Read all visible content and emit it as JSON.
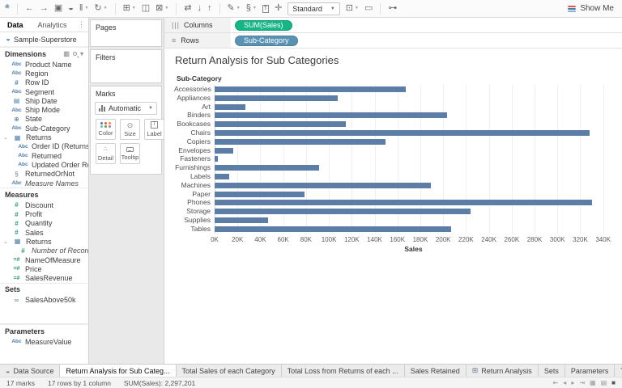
{
  "toolbar": {
    "icons": [
      {
        "name": "tableau-logo-icon",
        "glyph": "*",
        "logo": true
      },
      {
        "divider": true
      },
      {
        "name": "undo-icon",
        "glyph": "←"
      },
      {
        "name": "redo-icon",
        "glyph": "→"
      },
      {
        "name": "save-icon",
        "glyph": "▣"
      },
      {
        "name": "new-datasource-icon",
        "glyph": "◒"
      },
      {
        "name": "pause-auto-updates-icon",
        "glyph": "‖",
        "caret": true
      },
      {
        "name": "run-auto-updates-icon",
        "glyph": "↻",
        "caret": true
      },
      {
        "divider": true
      },
      {
        "name": "new-worksheet-icon",
        "glyph": "⊞",
        "caret": true
      },
      {
        "name": "duplicate-sheet-icon",
        "glyph": "◫"
      },
      {
        "name": "clear-sheet-icon",
        "glyph": "⊠",
        "caret": true
      },
      {
        "divider": true
      },
      {
        "name": "swap-rows-columns-icon",
        "glyph": "⇄"
      },
      {
        "name": "sort-ascending-icon",
        "glyph": "↓"
      },
      {
        "name": "sort-descending-icon",
        "glyph": "↑"
      },
      {
        "divider": true
      },
      {
        "name": "highlight-icon",
        "glyph": "✎",
        "caret": true
      },
      {
        "name": "group-members-icon",
        "glyph": "§",
        "caret": true
      },
      {
        "name": "show-mark-labels-icon",
        "glyph": "T",
        "boxed": true
      },
      {
        "name": "fix-axes-icon",
        "glyph": "✛"
      }
    ],
    "fit_mode": "Standard",
    "right_icons": [
      {
        "name": "fit-selector-icon",
        "glyph": "⊡",
        "caret": true
      },
      {
        "name": "presentation-mode-icon",
        "glyph": "▭"
      },
      {
        "divider": true
      },
      {
        "name": "share-icon",
        "glyph": "⊶"
      }
    ],
    "show_me_label": "Show Me",
    "show_me_colors": [
      "#e15759",
      "#4e79a7",
      "#86b4d8"
    ]
  },
  "sidebar": {
    "tabs": [
      {
        "label": "Data",
        "active": true
      },
      {
        "label": "Analytics",
        "active": false
      }
    ],
    "datasource": "Sample-Superstore",
    "sections": [
      {
        "header": "Dimensions",
        "header_icons": true,
        "items": [
          {
            "icon": "abc",
            "label": "Product Name"
          },
          {
            "icon": "abc",
            "label": "Region"
          },
          {
            "icon": "num-blue",
            "label": "Row ID"
          },
          {
            "icon": "abc",
            "label": "Segment"
          },
          {
            "icon": "calendar",
            "label": "Ship Date"
          },
          {
            "icon": "abc",
            "label": "Ship Mode"
          },
          {
            "icon": "globe",
            "label": "State"
          },
          {
            "icon": "abc",
            "label": "Sub-Category"
          },
          {
            "icon": "table",
            "label": "Returns",
            "caret": true
          },
          {
            "icon": "abc",
            "label": "Order ID (Returns)",
            "indent": true
          },
          {
            "icon": "abc",
            "label": "Returned",
            "indent": true
          },
          {
            "icon": "abc",
            "label": "Updated Order Returns",
            "indent": true
          },
          {
            "icon": "group",
            "label": "ReturnedOrNot"
          },
          {
            "icon": "abc",
            "label": "Measure Names",
            "italic": true
          }
        ]
      },
      {
        "header": "Measures",
        "items": [
          {
            "icon": "num-green",
            "label": "Discount"
          },
          {
            "icon": "num-green",
            "label": "Profit"
          },
          {
            "icon": "num-green",
            "label": "Quantity"
          },
          {
            "icon": "num-green",
            "label": "Sales"
          },
          {
            "icon": "table",
            "label": "Returns",
            "caret": true
          },
          {
            "icon": "num-green",
            "label": "Number of Records",
            "indent": true,
            "italic": true
          },
          {
            "icon": "calc-green",
            "label": "NameOfMeasure"
          },
          {
            "icon": "calc-green",
            "label": "Price"
          },
          {
            "icon": "calc-green",
            "label": "SalesRevenue"
          }
        ]
      },
      {
        "header": "Sets",
        "items": [
          {
            "icon": "set",
            "label": "SalesAbove50k"
          }
        ],
        "gap_after": true
      },
      {
        "header": "Parameters",
        "items": [
          {
            "icon": "abc",
            "label": "MeasureValue"
          }
        ]
      }
    ]
  },
  "cards": {
    "pages": {
      "title": "Pages"
    },
    "filters": {
      "title": "Filters"
    },
    "marks": {
      "title": "Marks",
      "type_label": "Automatic",
      "buttons": [
        {
          "label": "Color",
          "icon": "color-icon"
        },
        {
          "label": "Size",
          "icon": "size-icon"
        },
        {
          "label": "Label",
          "icon": "label-icon"
        },
        {
          "label": "Detail",
          "icon": "detail-icon"
        },
        {
          "label": "Tooltip",
          "icon": "tooltip-icon"
        }
      ],
      "color_dots": [
        "#4e79a7",
        "#e15759",
        "#f28e2b",
        "#76b7b2",
        "#59a14f",
        "#b07aa1"
      ]
    }
  },
  "shelves": {
    "columns": {
      "label": "Columns",
      "pills": [
        {
          "label": "SUM(Sales)",
          "color": "#17b586"
        }
      ]
    },
    "rows": {
      "label": "Rows",
      "pills": [
        {
          "label": "Sub-Category",
          "color": "#5a92b4"
        }
      ]
    }
  },
  "chart_data": {
    "type": "bar",
    "orientation": "horizontal",
    "title": "Return Analysis for Sub Categories",
    "row_header": "Sub-Category",
    "xlabel": "Sales",
    "categories": [
      "Accessories",
      "Appliances",
      "Art",
      "Binders",
      "Bookcases",
      "Chairs",
      "Copiers",
      "Envelopes",
      "Fasteners",
      "Furnishings",
      "Labels",
      "Machines",
      "Paper",
      "Phones",
      "Storage",
      "Supplies",
      "Tables"
    ],
    "values": [
      167380,
      107532,
      27119,
      203413,
      114880,
      328449,
      149528,
      16476,
      3024,
      91705,
      12486,
      189239,
      78479,
      330007,
      223844,
      46674,
      206966
    ],
    "xlim": [
      0,
      340000
    ],
    "tick_step": 20000,
    "ticks": [
      "0K",
      "20K",
      "40K",
      "60K",
      "80K",
      "100K",
      "120K",
      "140K",
      "160K",
      "180K",
      "200K",
      "220K",
      "240K",
      "260K",
      "280K",
      "300K",
      "320K",
      "340K"
    ],
    "bar_color": "#5b7da6",
    "gridlines": true,
    "legend": "none"
  },
  "tabs": [
    {
      "label": "Data Source",
      "type": "datasource"
    },
    {
      "label": "Return Analysis for Sub Categ...",
      "active": true
    },
    {
      "label": "Total Sales of each Category"
    },
    {
      "label": "Total Loss from Returns of each ..."
    },
    {
      "label": "Sales Retained"
    },
    {
      "label": "Return Analysis",
      "type": "dashboard"
    },
    {
      "label": "Sets"
    },
    {
      "label": "Parameters"
    },
    {
      "label": "TableCalculation"
    }
  ],
  "tab_buttons": [
    {
      "name": "new-worksheet-tab-button",
      "glyph": "⊞+"
    },
    {
      "name": "new-dashboard-tab-button",
      "glyph": "⊟+"
    },
    {
      "name": "new-story-tab-button",
      "glyph": "⊡+"
    }
  ],
  "status": {
    "marks": "17 marks",
    "rows_cols": "17 rows by 1 column",
    "aggregate": "SUM(Sales): 2,297,201",
    "nav_icons": [
      {
        "name": "first-sheet-icon",
        "glyph": "⇤"
      },
      {
        "name": "previous-sheet-icon",
        "glyph": "◂"
      },
      {
        "name": "next-sheet-icon",
        "glyph": "▸"
      },
      {
        "name": "last-sheet-icon",
        "glyph": "⇥"
      },
      {
        "name": "sheet-sorter-icon",
        "glyph": "▦"
      },
      {
        "name": "filmstrip-icon",
        "glyph": "▤"
      },
      {
        "name": "single-view-icon",
        "glyph": "■",
        "dark": true
      }
    ]
  }
}
